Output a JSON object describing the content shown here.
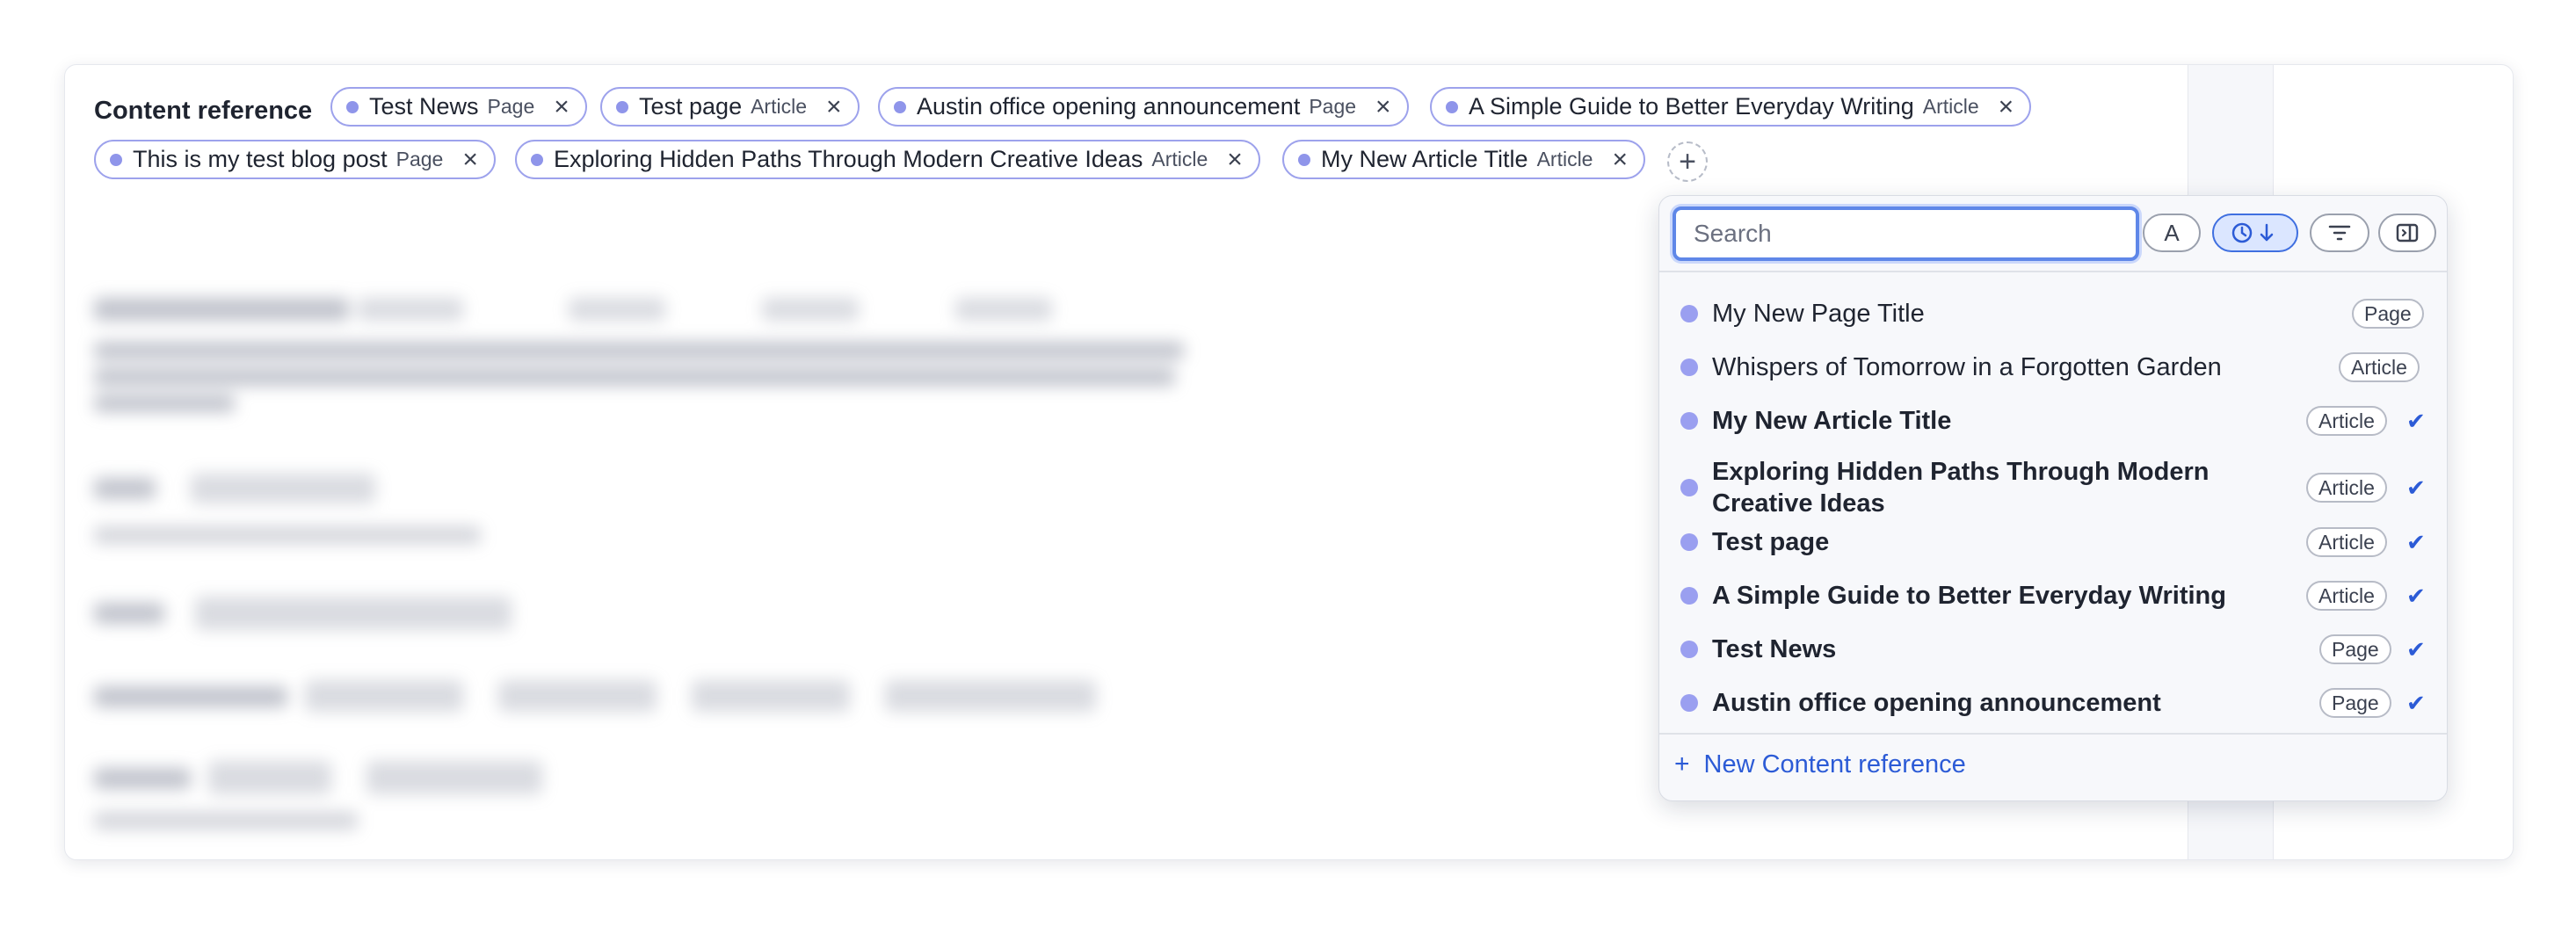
{
  "field": {
    "label": "Content reference"
  },
  "chips": [
    {
      "title": "Test News",
      "type": "Page"
    },
    {
      "title": "Test page",
      "type": "Article"
    },
    {
      "title": "Austin office opening announcement",
      "type": "Page"
    },
    {
      "title": "A Simple Guide to Better Everyday Writing",
      "type": "Article"
    },
    {
      "title": "This is my test blog post",
      "type": "Page"
    },
    {
      "title": "Exploring Hidden Paths Through Modern Creative Ideas",
      "type": "Article"
    },
    {
      "title": "My New Article Title",
      "type": "Article"
    }
  ],
  "icons": {
    "remove": "×",
    "add": "+",
    "check": "✔",
    "sort_alpha": "A"
  },
  "popover": {
    "search_placeholder": "Search",
    "items": [
      {
        "title": "My New Page Title",
        "type": "Page",
        "selected": false
      },
      {
        "title": "Whispers of Tomorrow in a Forgotten Garden",
        "type": "Article",
        "selected": false
      },
      {
        "title": "My New Article Title",
        "type": "Article",
        "selected": true
      },
      {
        "title": "Exploring Hidden Paths Through Modern Creative Ideas",
        "type": "Article",
        "selected": true
      },
      {
        "title": "Test page",
        "type": "Article",
        "selected": true
      },
      {
        "title": "A Simple Guide to Better Everyday Writing",
        "type": "Article",
        "selected": true
      },
      {
        "title": "Test News",
        "type": "Page",
        "selected": true
      },
      {
        "title": "Austin office opening announcement",
        "type": "Page",
        "selected": true
      }
    ],
    "new_label": "New Content reference"
  },
  "colors": {
    "accent": "#2c5bd6",
    "chip_border": "#9da2ec",
    "dot": "#8f95ea"
  }
}
